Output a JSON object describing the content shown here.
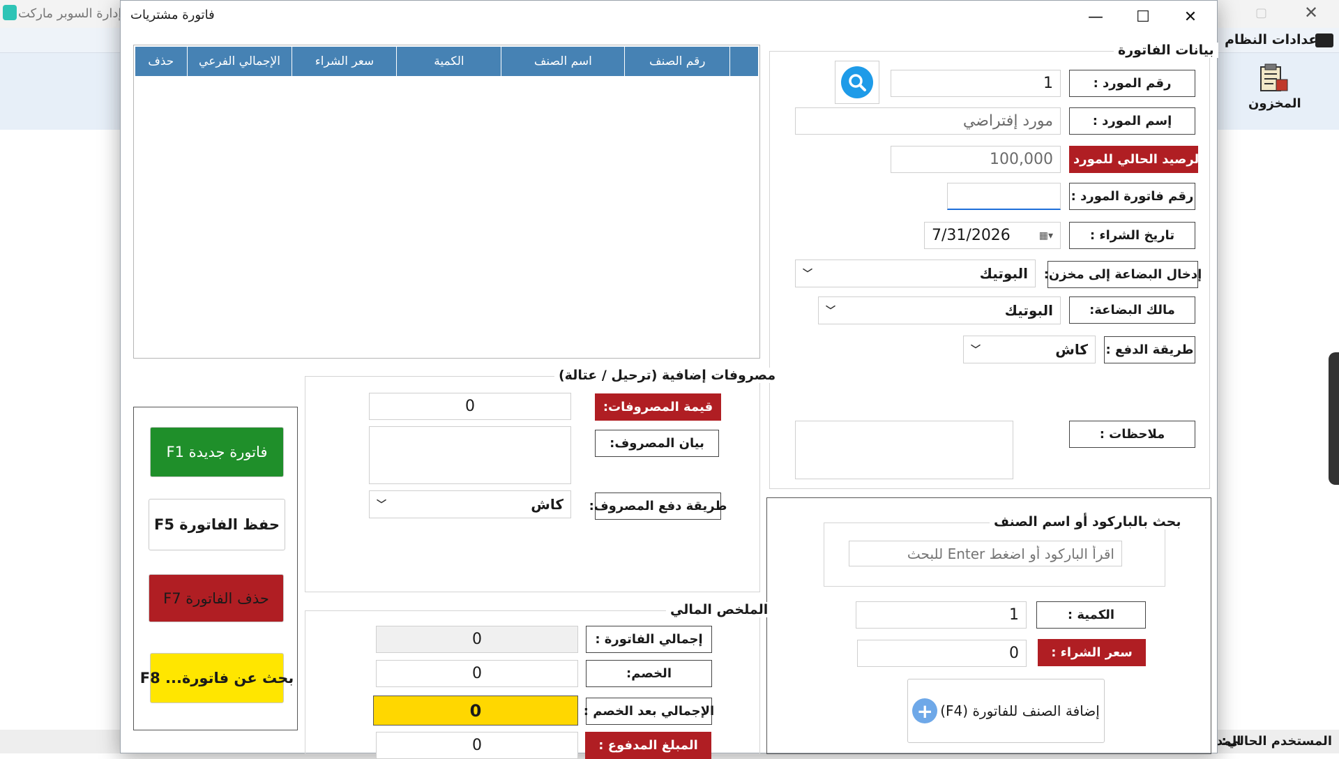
{
  "background_app": {
    "title": "إدارة السوبر ماركت",
    "menu_settings": "إعدادات النظام",
    "ribbon_inventory": "المخزون",
    "status_current_user": "المستخدم الحالي:",
    "status_user_fragment": "المد"
  },
  "dialog": {
    "title": "فاتورة مشتريات",
    "grid": {
      "columns": [
        "رقم الصنف",
        "اسم الصنف",
        "الكمية",
        "سعر الشراء",
        "الإجمالي الفرعي",
        "حذف"
      ],
      "rows": []
    },
    "invoice": {
      "group_title": "بيانات الفاتورة",
      "supplier_no_label": "رقم المورد :",
      "supplier_no_value": "1",
      "supplier_name_label": "إسم المورد :",
      "supplier_name_value": "مورد إفتراضي",
      "supplier_balance_label": "الرصيد الحالي للمورد :",
      "supplier_balance_value": "100,000",
      "supplier_invoice_no_label": "رقم فاتورة المورد :",
      "supplier_invoice_no_value": "",
      "purchase_date_label": "تاريخ الشراء :",
      "purchase_date_value": "7/31/2026",
      "store_label": "إدخال البضاعة إلى مخزن:",
      "store_value": "البوتيك",
      "owner_label": "مالك البضاعة:",
      "owner_value": "البوتيك",
      "payment_method_label": "طريقة الدفع :",
      "payment_method_value": "كاش",
      "notes_label": "ملاحظات :",
      "notes_value": ""
    },
    "expenses": {
      "group_title": "مصروفات إضافية (ترحيل / عتالة)",
      "amount_label": "قيمة المصروفات:",
      "amount_value": "0",
      "description_label": "بيان المصروف:",
      "description_value": "",
      "payment_method_label": "طريقة دفع المصروف:",
      "payment_method_value": "كاش"
    },
    "summary": {
      "group_title": "الملخص المالي",
      "total_label": "إجمالي الفاتورة :",
      "total_value": "0",
      "discount_label": "الخصم:",
      "discount_value": "0",
      "net_label": "الإجمالي بعد الخصم :",
      "net_value": "0",
      "paid_label": "المبلغ المدفوع :",
      "paid_value": "0"
    },
    "search": {
      "group_title": "بحث بالباركود أو اسم الصنف",
      "placeholder": "اقرأ الباركود أو اضغط Enter للبحث",
      "quantity_label": "الكمية :",
      "quantity_value": "1",
      "price_label": "سعر الشراء :",
      "price_value": "0",
      "add_button": "إضافة الصنف للفاتورة (F4)"
    },
    "actions": {
      "new_invoice": "فاتورة جديدة F1",
      "save_invoice": "حفظ الفاتورة F5",
      "delete_invoice": "حذف الفاتورة F7",
      "search_invoice": "بحث عن فاتورة... F8"
    }
  },
  "colors": {
    "grid_header": "#4682b4",
    "red_label": "#b01e23",
    "new_button": "#1f8f2a",
    "delete_button": "#b01e23",
    "search_button": "#ffe600",
    "net_total_field": "#ffd700",
    "search_icon_circle": "#1e9be8"
  },
  "icons": [
    "search-icon",
    "calendar-icon",
    "plus-circle-icon",
    "minimize-icon",
    "maximize-icon",
    "close-icon",
    "inventory-icon",
    "app-logo-icon",
    "wallet-icon"
  ]
}
